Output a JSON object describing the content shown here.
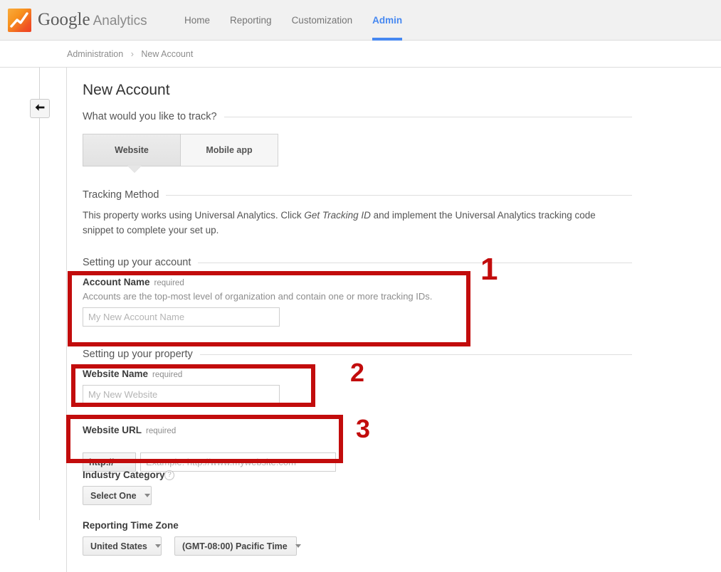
{
  "header": {
    "brand_google": "Google",
    "brand_product": "Analytics",
    "logo_icon": "analytics-logo-icon",
    "nav": [
      {
        "label": "Home",
        "active": false
      },
      {
        "label": "Reporting",
        "active": false
      },
      {
        "label": "Customization",
        "active": false
      },
      {
        "label": "Admin",
        "active": true
      }
    ],
    "accent_color": "#4688f1"
  },
  "breadcrumb": {
    "items": [
      "Administration",
      "New Account"
    ],
    "separator": "›"
  },
  "sidebar": {
    "collapse_button_icon": "arrow-left-icon",
    "collapse_button_label": "⬅"
  },
  "main": {
    "page_title": "New Account",
    "track_section": {
      "heading": "What would you like to track?",
      "tabs": [
        {
          "label": "Website",
          "selected": true
        },
        {
          "label": "Mobile app",
          "selected": false
        }
      ]
    },
    "tracking_method": {
      "heading": "Tracking Method",
      "body_part1": "This property works using Universal Analytics. Click ",
      "body_italic": "Get Tracking ID",
      "body_part2": " and implement the Universal Analytics tracking code snippet to complete your set up."
    },
    "account_section": {
      "heading": "Setting up your account",
      "account_name": {
        "label": "Account Name",
        "required_text": "required",
        "help": "Accounts are the top-most level of organization and contain one or more tracking IDs.",
        "value": "",
        "placeholder": "My New Account Name"
      }
    },
    "property_section": {
      "heading": "Setting up your property",
      "website_name": {
        "label": "Website Name",
        "required_text": "required",
        "value": "",
        "placeholder": "My New Website"
      },
      "website_url": {
        "label": "Website URL",
        "required_text": "required",
        "protocol_value": "http://",
        "value": "",
        "placeholder": "Example: http://www.mywebsite.com"
      },
      "industry_category": {
        "label": "Industry Category",
        "help_icon": "question-mark-icon",
        "help_glyph": "?",
        "selected": "Select One"
      },
      "time_zone": {
        "label": "Reporting Time Zone",
        "country_selected": "United States",
        "zone_selected": "(GMT-08:00) Pacific Time"
      }
    }
  },
  "annotations": {
    "color": "#c20c0c",
    "markers": [
      {
        "number": "1"
      },
      {
        "number": "2"
      },
      {
        "number": "3"
      }
    ]
  }
}
